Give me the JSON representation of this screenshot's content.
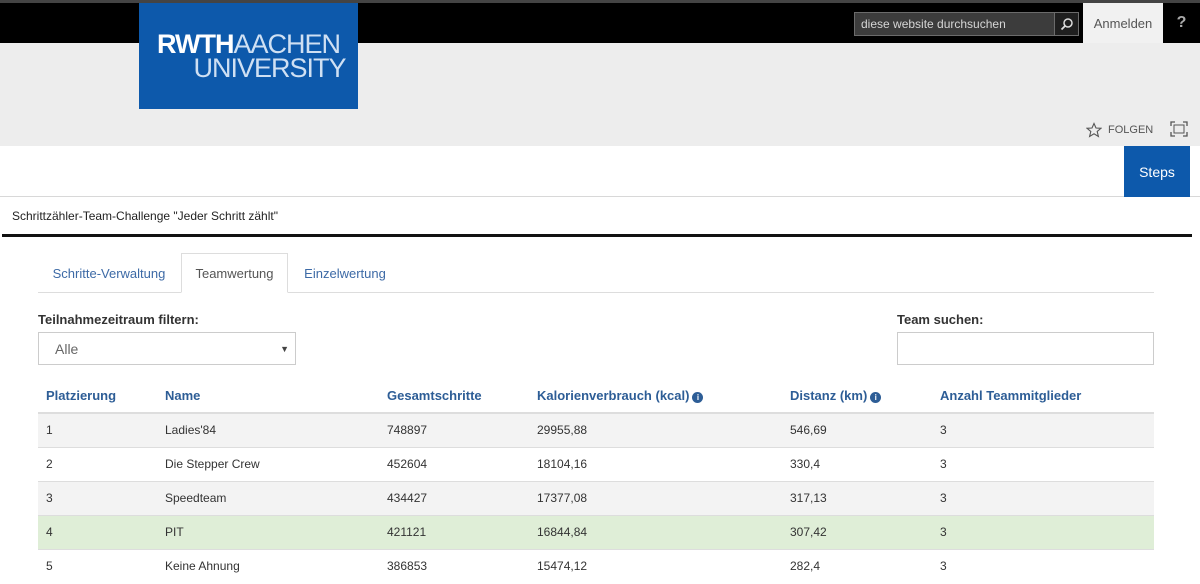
{
  "header": {
    "logo_line1_a": "RWTH",
    "logo_line1_b": "AACHEN",
    "logo_line2": "UNIVERSITY",
    "search_placeholder": "diese website durchsuchen",
    "signin_label": "Anmelden",
    "help_label": "?",
    "follow_label": "FOLGEN",
    "steps_label": "Steps"
  },
  "page": {
    "title": "Schrittzähler-Team-Challenge \"Jeder Schritt zählt\""
  },
  "tabs": [
    {
      "label": "Schritte-Verwaltung",
      "active": false
    },
    {
      "label": "Teamwertung",
      "active": true
    },
    {
      "label": "Einzelwertung",
      "active": false
    }
  ],
  "filters": {
    "period_label": "Teilnahmezeitraum filtern:",
    "period_value": "Alle",
    "team_search_label": "Team suchen:",
    "team_search_value": ""
  },
  "table": {
    "columns": [
      "Platzierung",
      "Name",
      "Gesamtschritte",
      "Kalorienverbrauch (kcal)",
      "Distanz (km)",
      "Anzahl Teammitglieder"
    ],
    "rows": [
      [
        "1",
        "Ladies'84",
        "748897",
        "29955,88",
        "546,69",
        "3"
      ],
      [
        "2",
        "Die Stepper Crew",
        "452604",
        "18104,16",
        "330,4",
        "3"
      ],
      [
        "3",
        "Speedteam",
        "434427",
        "17377,08",
        "317,13",
        "3"
      ],
      [
        "4",
        "PIT",
        "421121",
        "16844,84",
        "307,42",
        "3"
      ],
      [
        "5",
        "Keine Ahnung",
        "386853",
        "15474,12",
        "282,4",
        "3"
      ]
    ]
  },
  "colors": {
    "brand_blue": "#0d59ab",
    "link_blue": "#2d5d96",
    "highlight_row": "#dfeed7"
  }
}
